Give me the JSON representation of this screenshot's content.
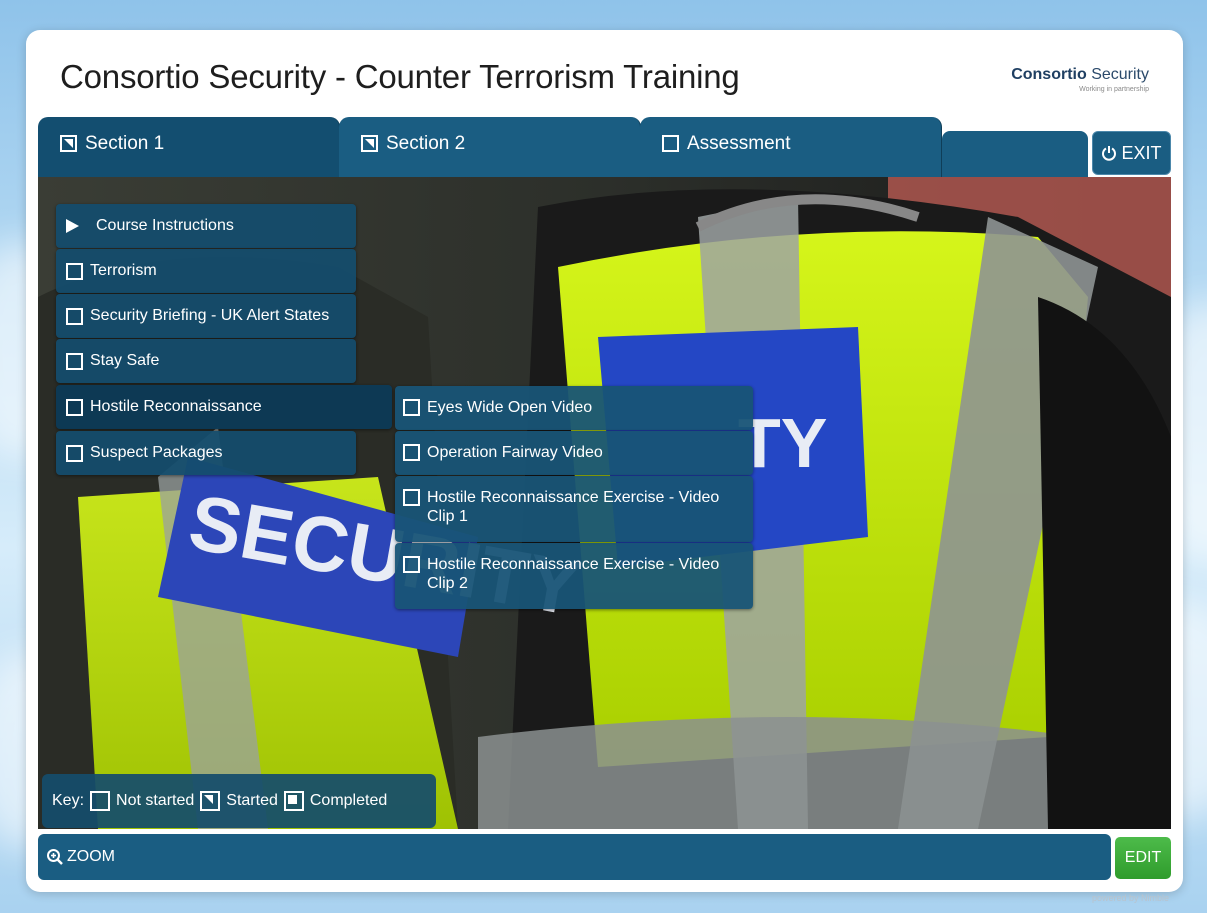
{
  "app": {
    "title": "Consortio Security - Counter Terrorism Training",
    "logo_brand": "Consortio",
    "logo_suffix": "Security",
    "logo_tagline": "Working in partnership"
  },
  "tabs": [
    {
      "label": "Section 1",
      "state": "started",
      "active": true
    },
    {
      "label": "Section 2",
      "state": "started",
      "active": false
    },
    {
      "label": "Assessment",
      "state": "not-started",
      "active": false
    }
  ],
  "exit": {
    "label": "EXIT",
    "icon": "power-icon"
  },
  "menu": {
    "items": [
      {
        "label": "Course Instructions",
        "state": "current"
      },
      {
        "label": "Terrorism",
        "state": "not-started"
      },
      {
        "label": "Security Briefing - UK Alert States",
        "state": "not-started"
      },
      {
        "label": "Stay Safe",
        "state": "not-started"
      },
      {
        "label": "Hostile Reconnaissance",
        "state": "not-started"
      },
      {
        "label": "Suspect Packages",
        "state": "not-started"
      }
    ],
    "submenu": [
      {
        "label": "Eyes Wide Open Video"
      },
      {
        "label": "Operation Fairway Video"
      },
      {
        "label": "Hostile Reconnaissance Exercise - Video Clip 1"
      },
      {
        "label": "Hostile Reconnaissance Exercise - Video Clip 2"
      }
    ]
  },
  "key": {
    "label": "Key:",
    "not_started": "Not started",
    "started": "Started",
    "completed": "Completed"
  },
  "bottombar": {
    "zoom_label": "ZOOM",
    "edit_label": "EDIT"
  },
  "footer": {
    "powered_by": "powered by Nimble"
  },
  "image": {
    "text_back": "SECURITY",
    "text_vest": "TY"
  },
  "colors": {
    "bar": "#1a5d82",
    "edit": "#3aa636",
    "vest": "#c8f000"
  }
}
